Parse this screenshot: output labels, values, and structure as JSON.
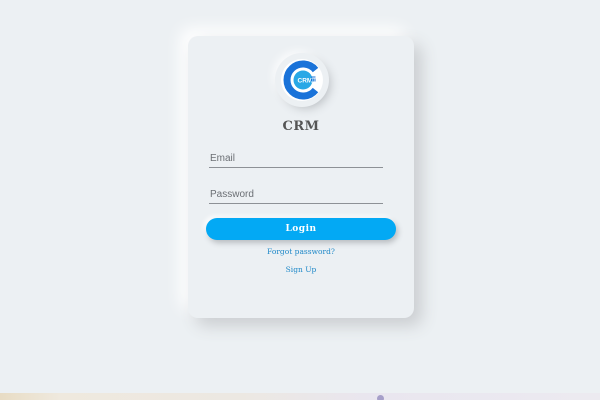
{
  "app": {
    "logo_text": "CRM",
    "logo_icon": "crm-logo-icon",
    "title": "CRM"
  },
  "form": {
    "email_placeholder": "Email",
    "password_placeholder": "Password",
    "login_label": "Login",
    "forgot_label": "Forgot password?",
    "signup_label": "Sign Up"
  },
  "colors": {
    "background": "#ecf0f3",
    "accent": "#03a9f4",
    "logo_blue": "#1a73d9",
    "link": "#1e88c8"
  }
}
